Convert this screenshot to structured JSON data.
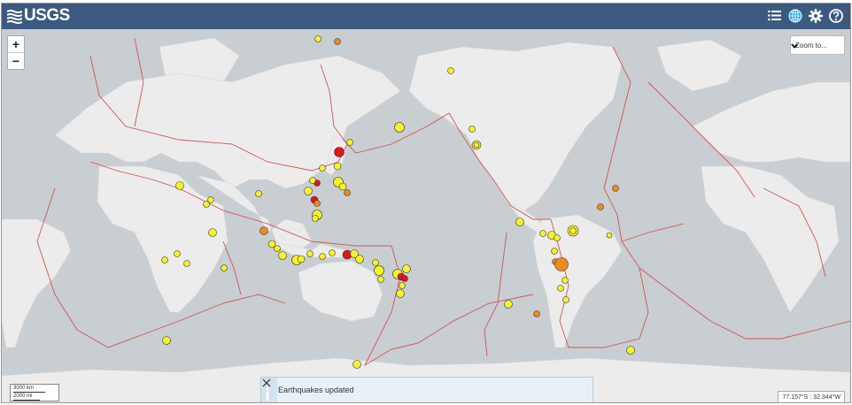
{
  "header": {
    "logo_text": "USGS",
    "tools": [
      {
        "icon": "list-icon"
      },
      {
        "icon": "globe-icon"
      },
      {
        "icon": "gear-icon"
      },
      {
        "icon": "help-icon"
      }
    ]
  },
  "map": {
    "zoom_in_label": "+",
    "zoom_out_label": "−",
    "zoom_to_label": "Zoom to...",
    "scale_km": "3000 km",
    "scale_mi": "2000 mi",
    "coords_text": "77.157°S : 32.344°W",
    "colors": {
      "ocean": "#c9ced2",
      "land": "#ececec",
      "plate_boundary": "#d45454",
      "quake_yellow": "#f6f22a",
      "quake_orange": "#f08a1f",
      "quake_red": "#e4141a"
    }
  },
  "toast": {
    "message": "Earthquakes updated"
  }
}
